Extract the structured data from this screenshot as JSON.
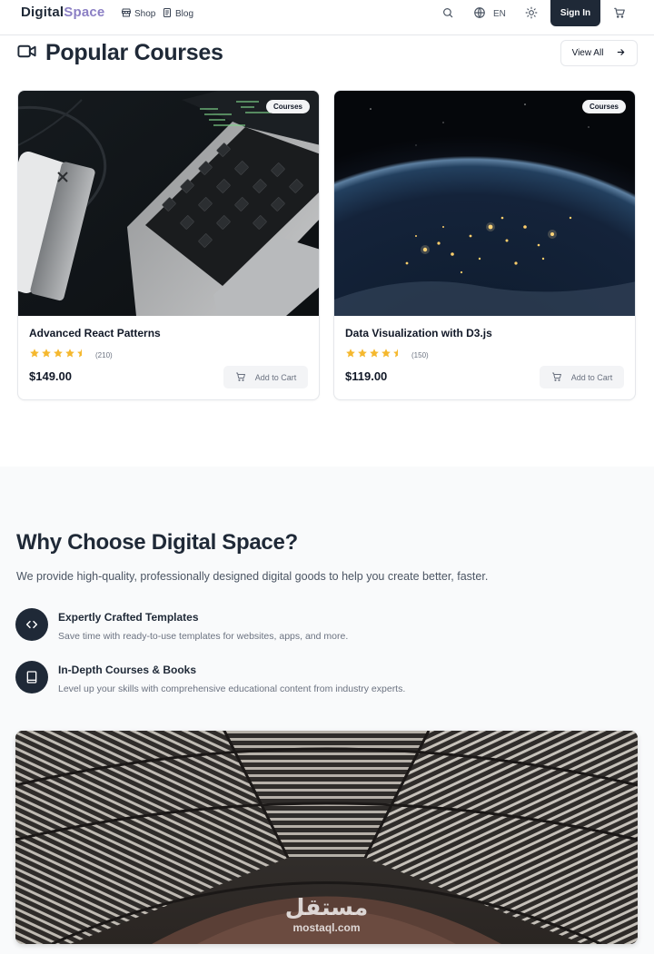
{
  "header": {
    "logo_part1": "Digital",
    "logo_part2": "Space",
    "nav": [
      {
        "label": "Shop",
        "icon": "store-icon"
      },
      {
        "label": "Blog",
        "icon": "document-icon"
      }
    ],
    "language": "EN",
    "sign_in_label": "Sign In"
  },
  "popular": {
    "title": "Popular Courses",
    "view_all_label": "View All",
    "cards": [
      {
        "badge": "Courses",
        "title": "Advanced React Patterns",
        "rating": 4.5,
        "reviews": "(210)",
        "price": "$149.00",
        "cart_label": "Add to Cart"
      },
      {
        "badge": "Courses",
        "title": "Data Visualization with D3.js",
        "rating": 4.5,
        "reviews": "(150)",
        "price": "$119.00",
        "cart_label": "Add to Cart"
      }
    ]
  },
  "why": {
    "title": "Why Choose Digital Space?",
    "description": "We provide high-quality, professionally designed digital goods to help you create better, faster.",
    "features": [
      {
        "icon": "code-icon",
        "title": "Expertly Crafted Templates",
        "description": "Save time with ready-to-use templates for websites, apps, and more."
      },
      {
        "icon": "book-icon",
        "title": "In-Depth Courses & Books",
        "description": "Level up your skills with comprehensive educational content from industry experts."
      }
    ],
    "watermark_ar": "مستقل",
    "watermark_en": "mostaql.com"
  },
  "colors": {
    "brand_dark": "#1f2937",
    "brand_accent": "#8b7fc4",
    "star": "#f5b82e"
  }
}
